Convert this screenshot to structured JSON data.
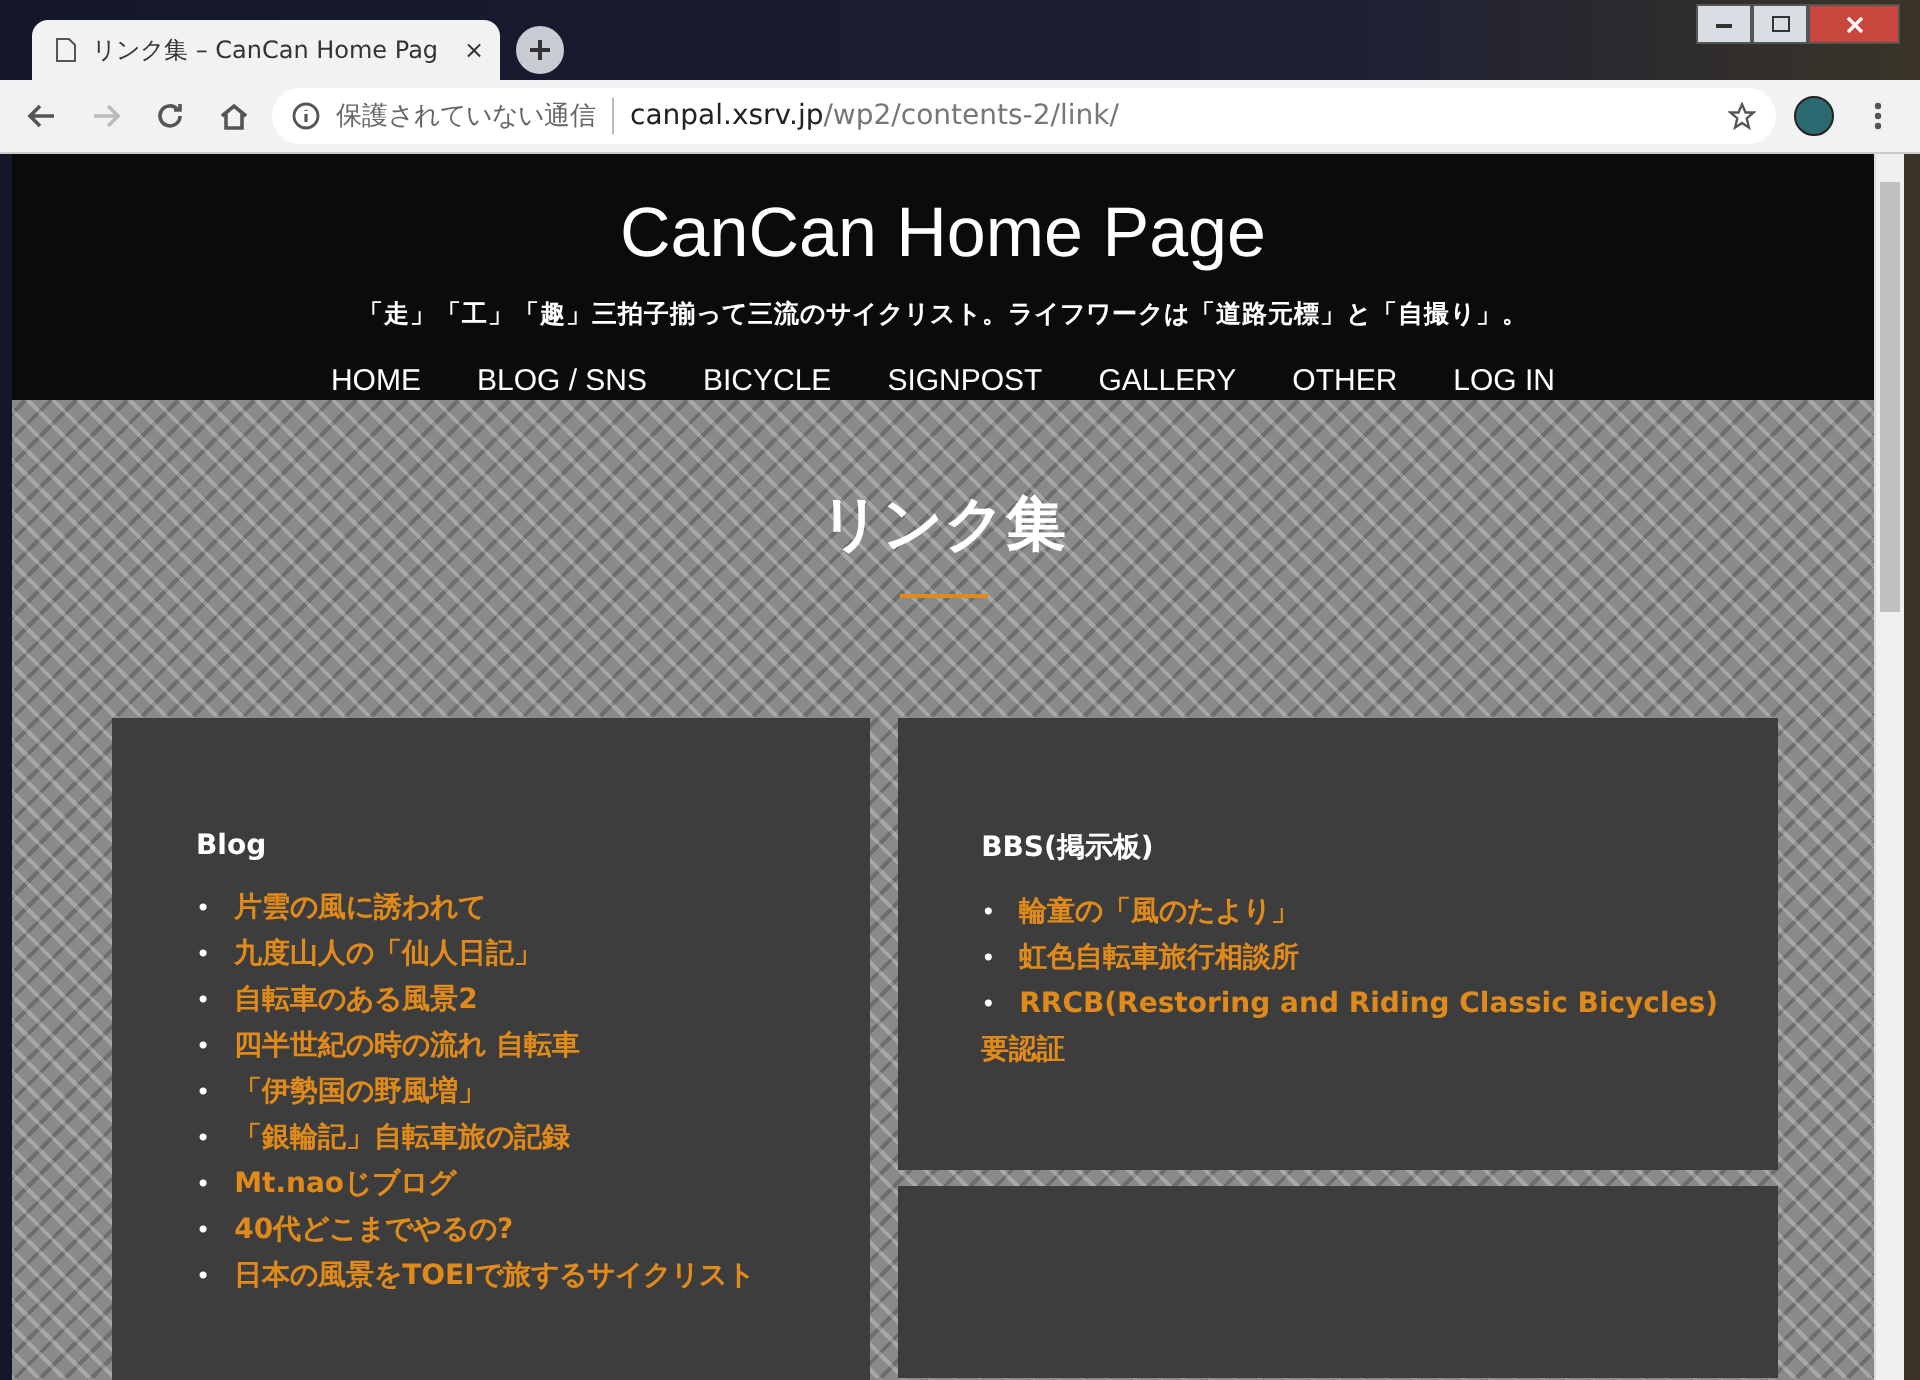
{
  "browser": {
    "tab_title": "リンク集 – CanCan Home Pag",
    "tab_close": "×",
    "security_label": "保護されていない通信",
    "address_host": "canpal.xsrv.jp",
    "address_path": "/wp2/contents-2/link/"
  },
  "site": {
    "title": "CanCan Home Page",
    "tagline": "「走」「工」「趣」三拍子揃って三流のサイクリスト。ライフワークは「道路元標」と「自撮り」。",
    "nav": [
      {
        "label": "HOME"
      },
      {
        "label": "BLOG / SNS"
      },
      {
        "label": "BICYCLE"
      },
      {
        "label": "SIGNPOST"
      },
      {
        "label": "GALLERY"
      },
      {
        "label": "OTHER"
      },
      {
        "label": "LOG IN"
      }
    ]
  },
  "page_title": "リンク集",
  "cards": [
    {
      "heading": "Blog",
      "bullet": "•",
      "links": [
        "片雲の風に誘われて",
        "九度山人の「仙人日記」",
        "自転車のある風景2",
        "四半世紀の時の流れ 自転車",
        "「伊勢国の野風増」",
        "「銀輪記」自転車旅の記録",
        "Mt.naoじブログ",
        "40代どこまでやるの?",
        "日本の風景をTOEIで旅するサイクリスト"
      ]
    },
    {
      "heading": "BBS(掲示板)",
      "bullet": "•",
      "links": [
        "輪童の「風のたより」",
        "虹色自転車旅行相談所",
        "RRCB(Restoring and Riding Classic Bicycles)"
      ],
      "note": "要認証"
    }
  ]
}
